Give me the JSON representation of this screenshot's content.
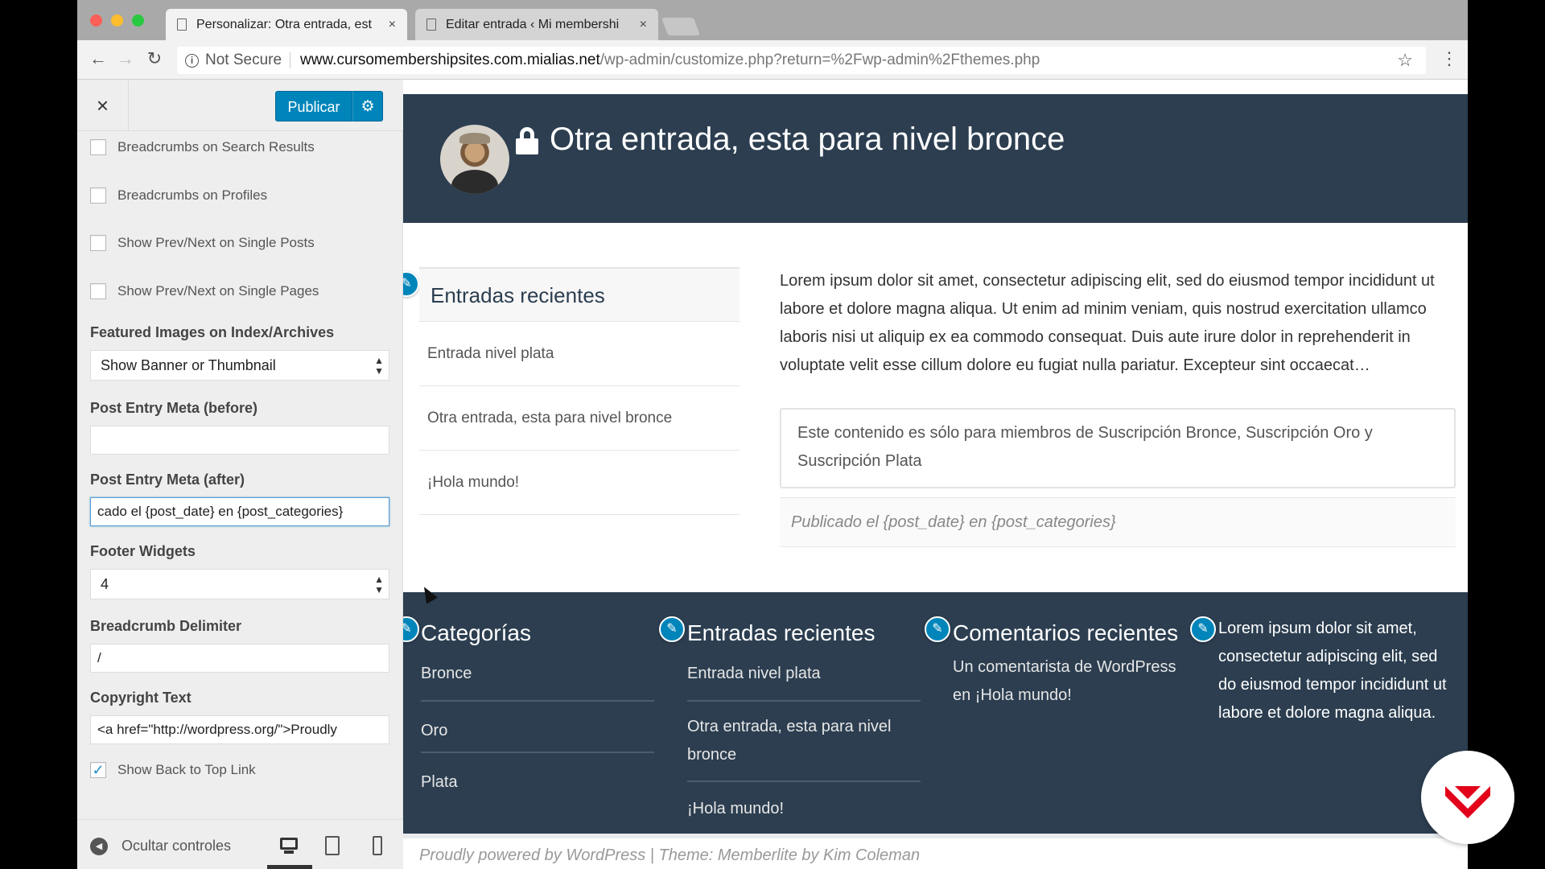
{
  "browser": {
    "tabs": [
      {
        "title": "Personalizar: Otra entrada, est",
        "close": "×"
      },
      {
        "title": "Editar entrada ‹ Mi membershi",
        "close": "×"
      }
    ],
    "not_secure": "Not Secure",
    "url_domain": "www.cursomembershipsites.com.mialias.net",
    "url_path": "/wp-admin/customize.php?return=%2Fwp-admin%2Fthemes.php",
    "back_icon": "←",
    "forward_icon": "→",
    "reload_icon": "↻",
    "star_icon": "☆",
    "menu_icon": "⋮"
  },
  "customizer": {
    "close_label": "×",
    "publish_label": "Publicar",
    "gear_label": "⚙",
    "checkboxes": [
      {
        "label": "Breadcrumbs on Search Results",
        "checked": false
      },
      {
        "label": "Breadcrumbs on Profiles",
        "checked": false
      },
      {
        "label": "Show Prev/Next on Single Posts",
        "checked": false
      },
      {
        "label": "Show Prev/Next on Single Pages",
        "checked": false
      }
    ],
    "featured_images": {
      "label": "Featured Images on Index/Archives",
      "value": "Show Banner or Thumbnail"
    },
    "meta_before": {
      "label": "Post Entry Meta (before)",
      "value": ""
    },
    "meta_after": {
      "label": "Post Entry Meta (after)",
      "value": "cado el {post_date} en {post_categories}"
    },
    "footer_widgets": {
      "label": "Footer Widgets",
      "value": "4"
    },
    "breadcrumb_delimiter": {
      "label": "Breadcrumb Delimiter",
      "value": "/"
    },
    "copyright": {
      "label": "Copyright Text",
      "value": "<a href=\"http://wordpress.org/\">Proudly"
    },
    "back_to_top": {
      "label": "Show Back to Top Link",
      "checked": true,
      "check": "✓"
    },
    "collapse_label": "Ocultar controles",
    "collapse_icon": "◀"
  },
  "preview": {
    "post_title": "Otra entrada, esta para nivel bronce",
    "recent_posts": {
      "title": "Entradas recientes",
      "items": [
        "Entrada nivel plata",
        "Otra entrada, esta para nivel bronce",
        "¡Hola mundo!"
      ]
    },
    "excerpt": "Lorem ipsum dolor sit amet, consectetur adipiscing elit, sed do eiusmod tempor incididunt ut labore et dolore magna aliqua. Ut enim ad minim veniam, quis nostrud exercitation ullamco laboris nisi ut aliquip ex ea commodo consequat. Duis aute irure dolor in reprehenderit in voluptate velit esse cillum dolore eu fugiat nulla pariatur. Excepteur sint occaecat…",
    "members_notice": "Este contenido es sólo para miembros de Suscripción Bronce, Suscripción Oro y Suscripción Plata",
    "post_meta": "Publicado el {post_date} en {post_categories}",
    "edit_icon": "✎",
    "footer": {
      "categories": {
        "title": "Categorías",
        "items": [
          "Bronce",
          "Oro",
          "Plata"
        ]
      },
      "recent": {
        "title": "Entradas recientes",
        "items": [
          "Entrada nivel plata",
          "Otra entrada, esta para nivel bronce",
          "¡Hola mundo!"
        ]
      },
      "comments": {
        "title": "Comentarios recientes",
        "text": "Un comentarista de WordPress en ¡Hola mundo!"
      },
      "text_widget": "Lorem ipsum dolor sit amet, consectetur adipiscing elit, sed do eiusmod tempor incididunt ut labore et dolore magna aliqua."
    },
    "credits": "Proudly powered by WordPress | Theme: Memberlite by Kim Coleman"
  },
  "colors": {
    "dark_navy": "#2c3e50",
    "wp_blue": "#0085ba",
    "logo_red": "#e2001a"
  }
}
